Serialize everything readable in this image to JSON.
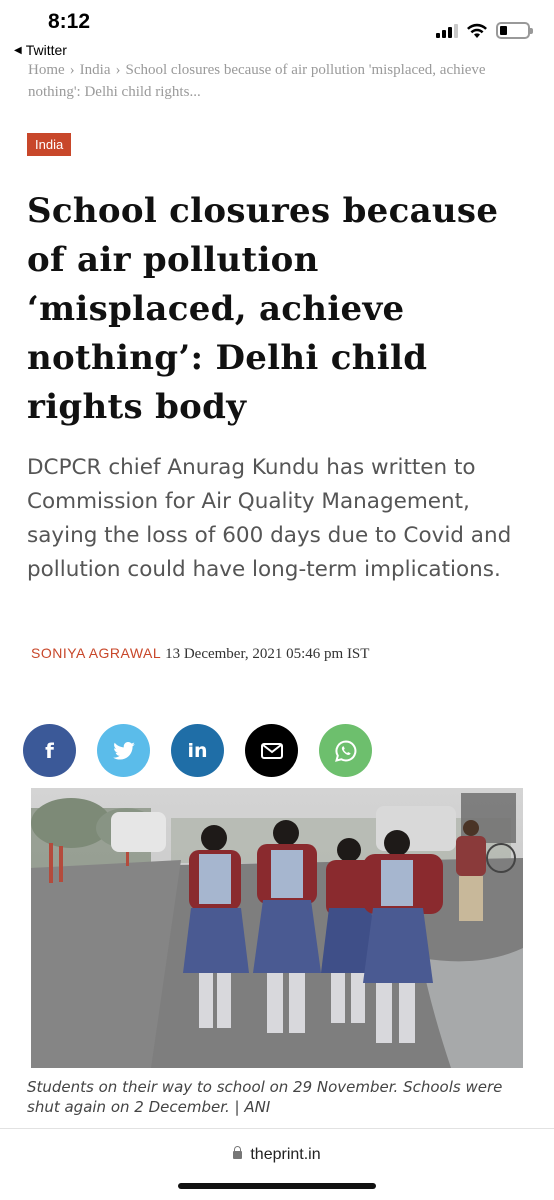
{
  "status_bar": {
    "time": "8:12",
    "back_app": "Twitter"
  },
  "breadcrumb": {
    "items": [
      "Home",
      "India",
      "School closures because of air pollution 'misplaced, achieve nothing': Delhi child rights..."
    ]
  },
  "article": {
    "category": "India",
    "headline": "School closures because of air pollution ‘misplaced, achieve nothing’: Delhi child rights body",
    "summary": "DCPCR chief Anurag Kundu has written to Commission for Air Quality Management, saying the loss of 600 days due to Covid and pollution could have long-term implications.",
    "author": "SONIYA AGRAWAL",
    "date": "13 December, 2021 05:46 pm IST",
    "caption": "Students on their way to school on 29 November. Schools were shut again on 2 December. | ANI"
  },
  "share": [
    {
      "name": "facebook",
      "glyph": "f",
      "color": "#3b5998"
    },
    {
      "name": "twitter",
      "color": "#5bbcea"
    },
    {
      "name": "linkedin",
      "glyph": "in",
      "color": "#1f6ea7"
    },
    {
      "name": "email",
      "color": "#000000"
    },
    {
      "name": "whatsapp",
      "color": "#6dbf6d"
    }
  ],
  "browser": {
    "domain": "theprint.in"
  },
  "colors": {
    "accent": "#c8472a"
  }
}
